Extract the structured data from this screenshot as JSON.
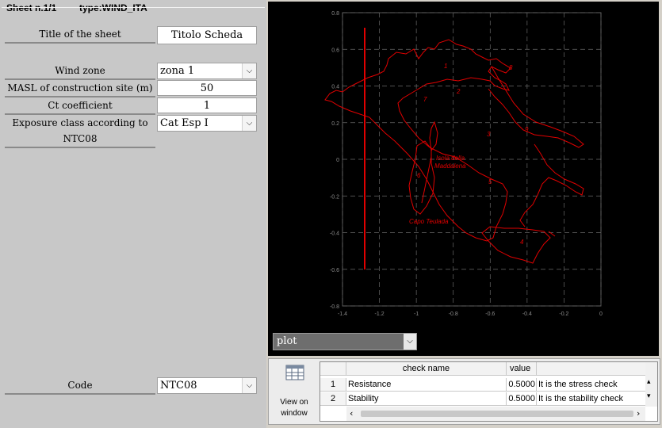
{
  "header": {
    "sheet": "Sheet n.1/1",
    "type": "type:WIND_ITA"
  },
  "form": {
    "title_label": "Title of the sheet",
    "title_value": "Titolo Scheda",
    "wind_zone_label": "Wind zone",
    "wind_zone_value": "zona 1",
    "masl_label": "MASL of construction site (m)",
    "masl_value": "50",
    "ct_label": "Ct coefficient",
    "ct_value": "1",
    "exposure_label": "Exposure class according to NTC08",
    "exposure_value": "Cat Esp I",
    "code_label": "Code",
    "code_value": "NTC08"
  },
  "plot": {
    "selector_value": "plot",
    "xticks": [
      "-1.4",
      "-1.2",
      "-1",
      "-0.8",
      "-0.6",
      "-0.4",
      "-0.2",
      "0"
    ],
    "yticks": [
      "0.8",
      "0.6",
      "0.4",
      "0.2",
      "0",
      "-0.2",
      "-0.4",
      "-0.6",
      "-0.8"
    ],
    "zone_labels": [
      "1",
      "2",
      "3",
      "4",
      "5",
      "6",
      "7",
      "8",
      "9"
    ],
    "place_labels": [
      "Isola della",
      "Maddalena",
      "Capo Teulada"
    ],
    "colors": {
      "background": "#000000",
      "grid": "#6a6a6a",
      "map": "#e00000"
    }
  },
  "view_button": {
    "line1": "View on",
    "line2": "window",
    "icon": "table-icon"
  },
  "checks": {
    "headers": [
      "check name",
      "value"
    ],
    "rows": [
      {
        "idx": "1",
        "name": "Resistance",
        "value": "0.5000",
        "note": "It is the stress check"
      },
      {
        "idx": "2",
        "name": "Stability",
        "value": "0.5000",
        "note": "It is the stability check"
      }
    ]
  }
}
